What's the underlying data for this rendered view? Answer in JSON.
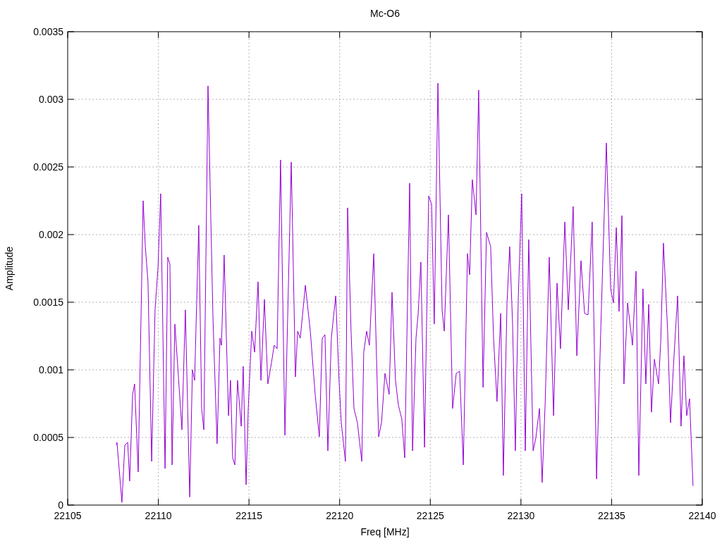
{
  "chart_data": {
    "type": "line",
    "title": "Mc-O6",
    "xlabel": "Freq [MHz]",
    "ylabel": "Amplitude",
    "xlim": [
      22105,
      22140
    ],
    "ylim": [
      0,
      0.0035
    ],
    "grid": true,
    "xticks": [
      22105,
      22110,
      22115,
      22120,
      22125,
      22130,
      22135,
      22140
    ],
    "yticks": [
      {
        "value": 0,
        "label": "0"
      },
      {
        "value": 0.0005,
        "label": "0.0005"
      },
      {
        "value": 0.001,
        "label": "0.001"
      },
      {
        "value": 0.0015,
        "label": "0.0015"
      },
      {
        "value": 0.002,
        "label": "0.002"
      },
      {
        "value": 0.0025,
        "label": "0.0025"
      },
      {
        "value": 0.003,
        "label": "0.003"
      },
      {
        "value": 0.0035,
        "label": "0.0035"
      }
    ],
    "x": [
      22107.68,
      22107.72,
      22107.99,
      22108.15,
      22108.31,
      22108.42,
      22108.58,
      22108.69,
      22108.89,
      22109.16,
      22109.28,
      22109.43,
      22109.63,
      22109.82,
      22109.98,
      22110.13,
      22110.37,
      22110.52,
      22110.64,
      22110.76,
      22110.91,
      22111.07,
      22111.3,
      22111.49,
      22111.73,
      22111.88,
      22112.0,
      22112.23,
      22112.39,
      22112.51,
      22112.74,
      22113.01,
      22113.24,
      22113.4,
      22113.48,
      22113.63,
      22113.87,
      22113.98,
      22114.1,
      22114.22,
      22114.37,
      22114.57,
      22114.68,
      22114.84,
      22114.96,
      22115.15,
      22115.31,
      22115.5,
      22115.66,
      22115.85,
      22116.04,
      22116.24,
      22116.39,
      22116.55,
      22116.74,
      22116.98,
      22117.33,
      22117.56,
      22117.68,
      22117.83,
      22118.11,
      22118.38,
      22118.65,
      22118.88,
      22119.04,
      22119.19,
      22119.35,
      22119.54,
      22119.78,
      22119.97,
      22120.09,
      22120.32,
      22120.44,
      22120.63,
      22120.79,
      22120.98,
      22121.22,
      22121.33,
      22121.49,
      22121.64,
      22121.88,
      22122.15,
      22122.31,
      22122.5,
      22122.73,
      22122.89,
      22123.08,
      22123.24,
      22123.43,
      22123.59,
      22123.86,
      22124.02,
      22124.21,
      22124.33,
      22124.48,
      22124.68,
      22124.91,
      22125.07,
      22125.22,
      22125.42,
      22125.65,
      22125.77,
      22126.0,
      22126.23,
      22126.43,
      22126.62,
      22126.82,
      22127.05,
      22127.17,
      22127.32,
      22127.52,
      22127.67,
      22127.91,
      22128.1,
      22128.33,
      22128.49,
      22128.68,
      22128.88,
      22129.03,
      22129.23,
      22129.38,
      22129.54,
      22129.69,
      22129.85,
      22130.04,
      22130.24,
      22130.43,
      22130.67,
      22130.82,
      22131.02,
      22131.17,
      22131.33,
      22131.56,
      22131.8,
      22131.99,
      22132.18,
      22132.42,
      22132.61,
      22132.88,
      22133.08,
      22133.31,
      22133.51,
      22133.7,
      22133.93,
      22134.17,
      22134.4,
      22134.71,
      22134.95,
      22135.1,
      22135.26,
      22135.41,
      22135.57,
      22135.68,
      22135.88,
      22136.15,
      22136.35,
      22136.5,
      22136.73,
      22136.89,
      22137.05,
      22137.2,
      22137.36,
      22137.59,
      22137.71,
      22137.86,
      22138.09,
      22138.25,
      22138.41,
      22138.64,
      22138.83,
      22138.99,
      22139.14,
      22139.3,
      22139.49
    ],
    "series": [
      {
        "color": "#9400d3",
        "values": [
          0.000443,
          0.000464,
          2e-05,
          0.000443,
          0.000464,
          0.000177,
          0.000818,
          0.000896,
          0.000245,
          0.00225,
          0.001911,
          0.001651,
          0.000323,
          0.001443,
          0.001755,
          0.002302,
          0.000271,
          0.001833,
          0.001781,
          0.000297,
          0.001338,
          0.001026,
          0.000557,
          0.001443,
          6e-05,
          0.001,
          0.000922,
          0.002068,
          0.000714,
          0.000557,
          0.003099,
          0.001391,
          0.000453,
          0.001234,
          0.001182,
          0.001849,
          0.000661,
          0.000922,
          0.000349,
          0.000297,
          0.000922,
          0.000583,
          0.001026,
          0.000151,
          0.000714,
          0.001286,
          0.00113,
          0.001651,
          0.000922,
          0.001521,
          0.000896,
          0.001052,
          0.001182,
          0.001156,
          0.002552,
          0.000516,
          0.002536,
          0.000948,
          0.001286,
          0.001234,
          0.001625,
          0.001286,
          0.000818,
          0.000505,
          0.001234,
          0.00126,
          0.000401,
          0.001234,
          0.001547,
          0.000922,
          0.000609,
          0.000323,
          0.002198,
          0.001286,
          0.000714,
          0.000609,
          0.000323,
          0.00113,
          0.001286,
          0.001182,
          0.001859,
          0.000505,
          0.000609,
          0.000974,
          0.000818,
          0.001573,
          0.000922,
          0.00074,
          0.000635,
          0.000349,
          0.00238,
          0.000401,
          0.001234,
          0.001417,
          0.001797,
          0.000427,
          0.002286,
          0.002224,
          0.001338,
          0.00312,
          0.001443,
          0.001286,
          0.002146,
          0.000714,
          0.000974,
          0.00099,
          0.000297,
          0.001859,
          0.001703,
          0.002406,
          0.002146,
          0.003068,
          0.00087,
          0.002016,
          0.001911,
          0.001234,
          0.000766,
          0.001417,
          0.000219,
          0.001495,
          0.001911,
          0.001338,
          0.000401,
          0.001521,
          0.002302,
          0.000401,
          0.001963,
          0.000401,
          0.000495,
          0.000714,
          0.000167,
          0.00074,
          0.001833,
          0.000661,
          0.001641,
          0.001156,
          0.002094,
          0.001443,
          0.002208,
          0.001104,
          0.001807,
          0.001417,
          0.001406,
          0.002094,
          0.000193,
          0.001286,
          0.002677,
          0.001599,
          0.001495,
          0.002052,
          0.001432,
          0.00214,
          0.000896,
          0.001495,
          0.001182,
          0.001729,
          0.000219,
          0.001599,
          0.000896,
          0.001484,
          0.000687,
          0.001078,
          0.000896,
          0.001208,
          0.001937,
          0.001286,
          0.000609,
          0.001026,
          0.001547,
          0.000583,
          0.001104,
          0.000661,
          0.000786,
          0.000141
        ]
      }
    ]
  }
}
